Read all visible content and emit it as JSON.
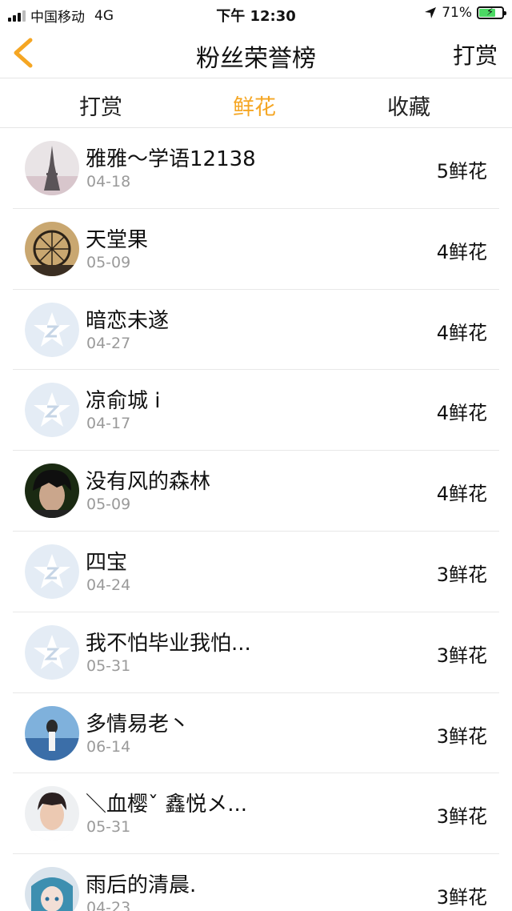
{
  "status_bar": {
    "carrier": "中国移动",
    "network": "4G",
    "time": "下午 12:30",
    "battery_percent": "71%",
    "battery_level": 0.71
  },
  "nav": {
    "title": "粉丝荣誉榜",
    "right_label": "打赏",
    "back_icon": "chevron-left-icon",
    "accent": "#f5a623"
  },
  "tabs": [
    {
      "label": "打赏",
      "active": false
    },
    {
      "label": "鲜花",
      "active": true
    },
    {
      "label": "收藏",
      "active": false
    }
  ],
  "fans": [
    {
      "name": "雅雅～学语12138",
      "date": "04-18",
      "score": "5鲜花",
      "avatar": "photo-eiffel"
    },
    {
      "name": "天堂果",
      "date": "05-09",
      "score": "4鲜花",
      "avatar": "photo-ferris-wheel"
    },
    {
      "name": "暗恋未遂",
      "date": "04-27",
      "score": "4鲜花",
      "avatar": "default-qq"
    },
    {
      "name": "凉俞城 i",
      "date": "04-17",
      "score": "4鲜花",
      "avatar": "default-qq"
    },
    {
      "name": "没有风的森林",
      "date": "05-09",
      "score": "4鲜花",
      "avatar": "photo-person-dark"
    },
    {
      "name": "四宝",
      "date": "04-24",
      "score": "3鲜花",
      "avatar": "default-qq"
    },
    {
      "name": "我不怕毕业我怕...",
      "date": "05-31",
      "score": "3鲜花",
      "avatar": "default-qq"
    },
    {
      "name": "多情易老丶",
      "date": "06-14",
      "score": "3鲜花",
      "avatar": "photo-sea"
    },
    {
      "name": "＼血樱ˇ 鑫悦メ...",
      "date": "05-31",
      "score": "3鲜花",
      "avatar": "photo-person-light"
    },
    {
      "name": "雨后的清晨.",
      "date": "04-23",
      "score": "3鲜花",
      "avatar": "photo-anime"
    }
  ]
}
